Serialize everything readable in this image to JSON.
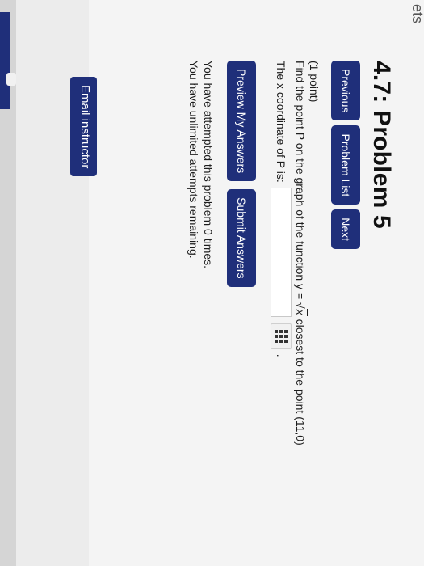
{
  "sidebar": {
    "sets_label": "ets",
    "email_instructor": "Email instructor"
  },
  "page": {
    "title": "4.7: Problem 5"
  },
  "nav": {
    "previous": "Previous",
    "problem_list": "Problem List",
    "next": "Next"
  },
  "problem": {
    "points": "(1 point)",
    "prompt_before": "Find the point P on the graph of the function y =",
    "sqrt_var": "x",
    "prompt_after": "closest to the point (11,0)",
    "answer_label": "The x coordinate of P is:",
    "answer_value": "",
    "period": "."
  },
  "actions": {
    "preview": "Preview My Answers",
    "submit": "Submit Answers"
  },
  "attempts": {
    "line1": "You have attempted this problem 0 times.",
    "line2": "You have unlimited attempts remaining."
  }
}
